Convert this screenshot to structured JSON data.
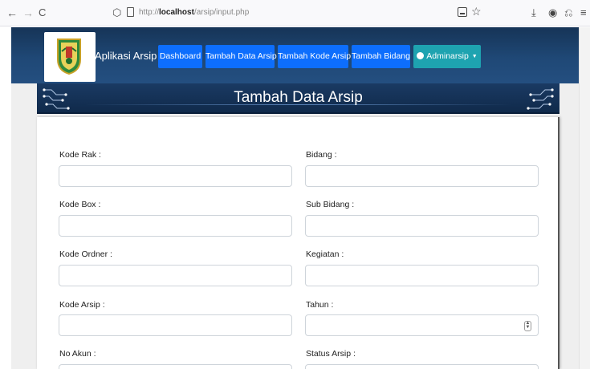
{
  "browser": {
    "back": "←",
    "forward": "→",
    "reload": "C",
    "url_prefix": "http://",
    "url_host": "localhost",
    "url_path": "/arsip/input.php"
  },
  "app": {
    "brand": "Aplikasi Arsip",
    "nav": {
      "dashboard": "Dashboard",
      "tambah_data_arsip": "Tambah Data Arsip",
      "tambah_kode_arsip": "Tambah Kode Arsip",
      "tambah_bidang": "Tambah Bidang",
      "user": "Adminarsip"
    }
  },
  "page": {
    "title": "Tambah Data Arsip"
  },
  "form": {
    "left": [
      {
        "label": "Kode Rak :",
        "value": ""
      },
      {
        "label": "Kode Box :",
        "value": ""
      },
      {
        "label": "Kode Ordner :",
        "value": ""
      },
      {
        "label": "Kode Arsip :",
        "value": ""
      },
      {
        "label": "No Akun :",
        "value": ""
      }
    ],
    "right": [
      {
        "label": "Bidang :",
        "value": ""
      },
      {
        "label": "Sub Bidang :",
        "value": ""
      },
      {
        "label": "Kegiatan :",
        "value": ""
      },
      {
        "label": "Tahun :",
        "value": ""
      },
      {
        "label": "Status Arsip :",
        "value": ""
      }
    ]
  },
  "colors": {
    "nav_primary": "#0d6efd",
    "nav_user": "#1ea3b0",
    "header_band": "#1f4876"
  }
}
